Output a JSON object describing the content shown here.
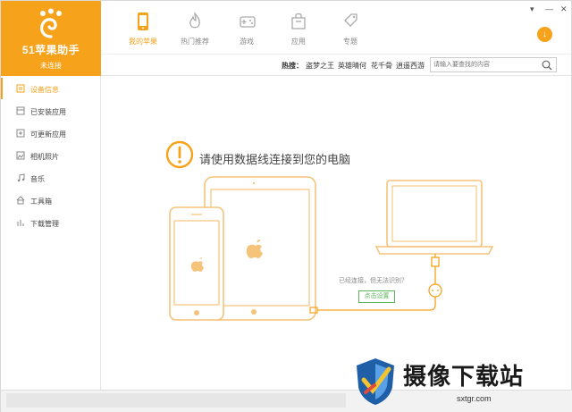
{
  "app": {
    "title": "51苹果助手",
    "status": "未连接"
  },
  "nav": {
    "items": [
      {
        "label": "我的苹果",
        "icon": "phone-icon"
      },
      {
        "label": "热门推荐",
        "icon": "flame-icon"
      },
      {
        "label": "游戏",
        "icon": "gamepad-icon"
      },
      {
        "label": "应用",
        "icon": "bag-icon"
      },
      {
        "label": "专题",
        "icon": "tag-icon"
      }
    ],
    "active_index": 0
  },
  "window": {
    "menu_glyph": "▾",
    "minimize_glyph": "—",
    "close_glyph": "✕",
    "download_glyph": "↓"
  },
  "hot": {
    "label": "热搜：",
    "terms": [
      "盗梦之王",
      "英雄晴何",
      "花千骨",
      "逍遥西游"
    ]
  },
  "search": {
    "placeholder": "请输入要查找的内容"
  },
  "sidebar": {
    "items": [
      {
        "label": "设备信息",
        "icon": "info-icon"
      },
      {
        "label": "已安装应用",
        "icon": "installed-icon"
      },
      {
        "label": "可更新应用",
        "icon": "update-icon"
      },
      {
        "label": "相机照片",
        "icon": "photo-icon"
      },
      {
        "label": "音乐",
        "icon": "music-icon"
      },
      {
        "label": "工具箱",
        "icon": "toolbox-icon"
      },
      {
        "label": "下载管理",
        "icon": "download-icon"
      }
    ],
    "active_index": 0
  },
  "main": {
    "title": "请使用数据线连接到您的电脑",
    "hint": "已经连接，但无法识别？",
    "setup_button": "点击设置"
  },
  "watermark": {
    "text": "摄像下载站",
    "url": "sxtgr.com"
  },
  "colors": {
    "accent": "#f6a21b",
    "green": "#5ab45a",
    "device_line": "#f5c37a"
  }
}
